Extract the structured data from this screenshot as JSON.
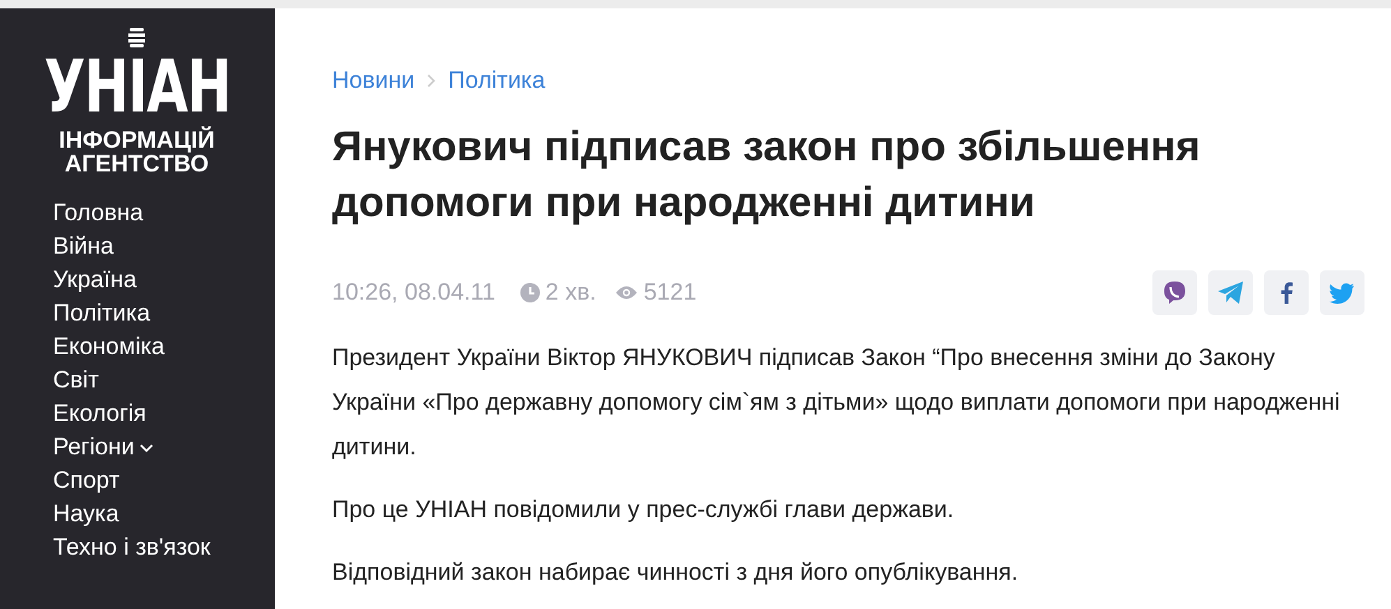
{
  "sidebar": {
    "logo": {
      "wordmark": "УНІАН",
      "tagline": [
        "ІНФОРМАЦІЙ",
        "АГЕНТСТВО"
      ]
    },
    "items": [
      {
        "label": "Головна",
        "has_submenu": false
      },
      {
        "label": "Війна",
        "has_submenu": false
      },
      {
        "label": "Україна",
        "has_submenu": false
      },
      {
        "label": "Політика",
        "has_submenu": false
      },
      {
        "label": "Економіка",
        "has_submenu": false
      },
      {
        "label": "Світ",
        "has_submenu": false
      },
      {
        "label": "Екологія",
        "has_submenu": false
      },
      {
        "label": "Регіони",
        "has_submenu": true
      },
      {
        "label": "Спорт",
        "has_submenu": false
      },
      {
        "label": "Наука",
        "has_submenu": false
      },
      {
        "label": "Техно і зв'язок",
        "has_submenu": false
      }
    ]
  },
  "breadcrumbs": [
    "Новини",
    "Політика"
  ],
  "article": {
    "title": "Янукович підписав закон про збільшення допомоги при народженні дитини",
    "meta": {
      "datetime": "10:26, 08.04.11",
      "read_time": "2 хв.",
      "views": "5121"
    },
    "share": [
      {
        "kind": "viber"
      },
      {
        "kind": "telegram"
      },
      {
        "kind": "facebook"
      },
      {
        "kind": "twitter"
      }
    ],
    "paragraphs": [
      " Президент України Віктор ЯНУКОВИЧ підписав Закон “Про внесення зміни до Закону України «Про державну допомогу сім`ям з дітьми» щодо виплати допомоги при народженні дитини.",
      "Про це УНІАН повідомили у прес-службі глави держави.",
      "Відповідний закон набирає чинності з дня його опублікування."
    ]
  }
}
